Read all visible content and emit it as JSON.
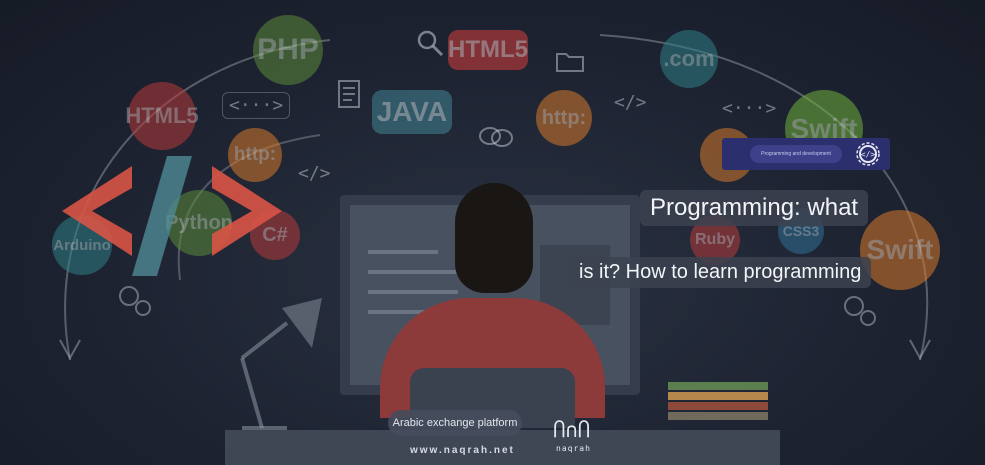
{
  "background": {
    "bubbles": [
      {
        "label": "PHP",
        "color": "#5a8a3a"
      },
      {
        "label": "HTML5",
        "color": "#c63b3b"
      },
      {
        "label": ".com",
        "color": "#2f7f86"
      },
      {
        "label": "HTML5",
        "color": "#b63a3a"
      },
      {
        "label": "JAVA",
        "color": "#3f7c8c"
      },
      {
        "label": "http:",
        "color": "#d4792b"
      },
      {
        "label": "http:",
        "color": "#d4792b"
      },
      {
        "label": "Swift",
        "color": "#6fb03a"
      },
      {
        "label": "Swift",
        "color": "#d8792b"
      },
      {
        "label": "Python",
        "color": "#5a8a3a"
      },
      {
        "label": "C#",
        "color": "#b63a3a"
      },
      {
        "label": "Arduino",
        "color": "#2f7f86"
      },
      {
        "label": "Ruby",
        "color": "#b63a3a"
      },
      {
        "label": "CSS3",
        "color": "#2f6f96"
      }
    ],
    "symbols": [
      "<···>",
      "</>",
      "</>",
      "<···>"
    ],
    "code_logo_color": "#d95446"
  },
  "badge": {
    "label": "Programming and development",
    "icon": "gear-code-icon"
  },
  "headline": {
    "line1": "Programming: what",
    "line2": "is it? How to learn programming"
  },
  "footer": {
    "platform": "Arabic exchange platform",
    "url": "www.naqrah.net",
    "logo_text": "naqrah"
  }
}
